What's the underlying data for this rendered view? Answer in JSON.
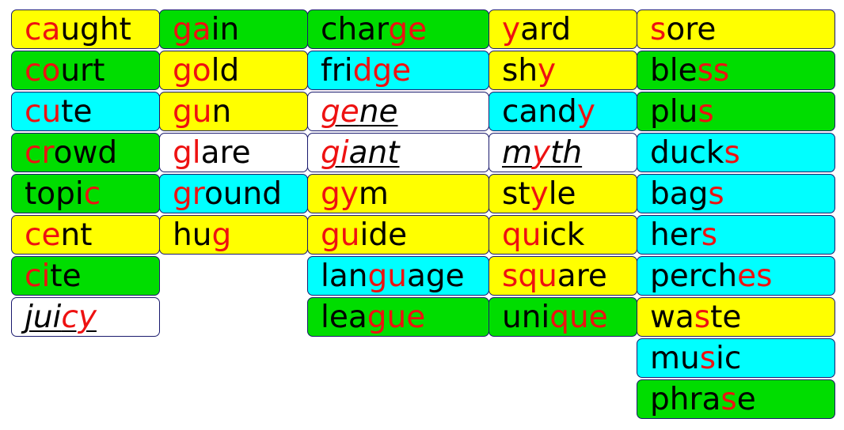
{
  "colors": {
    "yellow": "#ffff00",
    "green": "#00dd00",
    "cyan": "#00ffff",
    "white": "#ffffff",
    "highlight": "#ee1111",
    "text": "#000000"
  },
  "columns": [
    [
      {
        "word": "caught",
        "color": "yellow",
        "parts": [
          {
            "t": "ca",
            "h": true
          },
          {
            "t": "ught"
          }
        ]
      },
      {
        "word": "court",
        "color": "green",
        "parts": [
          {
            "t": "co",
            "h": true
          },
          {
            "t": "urt"
          }
        ]
      },
      {
        "word": "cute",
        "color": "cyan",
        "parts": [
          {
            "t": "cu",
            "h": true
          },
          {
            "t": "te"
          }
        ]
      },
      {
        "word": "crowd",
        "color": "green",
        "parts": [
          {
            "t": "cr",
            "h": true
          },
          {
            "t": "owd"
          }
        ]
      },
      {
        "word": "topic",
        "color": "green",
        "parts": [
          {
            "t": "topi"
          },
          {
            "t": "c",
            "h": true
          }
        ]
      },
      {
        "word": "cent",
        "color": "yellow",
        "parts": [
          {
            "t": "ce",
            "h": true
          },
          {
            "t": "nt"
          }
        ]
      },
      {
        "word": "cite",
        "color": "green",
        "parts": [
          {
            "t": "ci",
            "h": true
          },
          {
            "t": "te"
          }
        ]
      },
      {
        "word": "juicy",
        "color": "white",
        "italic": true,
        "parts": [
          {
            "t": "jui"
          },
          {
            "t": "cy",
            "h": true
          }
        ]
      }
    ],
    [
      {
        "word": "gain",
        "color": "green",
        "parts": [
          {
            "t": "ga",
            "h": true
          },
          {
            "t": "in"
          }
        ]
      },
      {
        "word": "gold",
        "color": "yellow",
        "parts": [
          {
            "t": "go",
            "h": true
          },
          {
            "t": "ld"
          }
        ]
      },
      {
        "word": "gun",
        "color": "yellow",
        "parts": [
          {
            "t": "gu",
            "h": true
          },
          {
            "t": "n"
          }
        ]
      },
      {
        "word": "glare",
        "color": "white",
        "parts": [
          {
            "t": "gl",
            "h": true
          },
          {
            "t": "are"
          }
        ]
      },
      {
        "word": "ground",
        "color": "cyan",
        "parts": [
          {
            "t": "gr",
            "h": true
          },
          {
            "t": "ound"
          }
        ]
      },
      {
        "word": "hug",
        "color": "yellow",
        "parts": [
          {
            "t": "hu"
          },
          {
            "t": "g",
            "h": true
          }
        ]
      }
    ],
    [
      {
        "word": "charge",
        "color": "green",
        "parts": [
          {
            "t": "char"
          },
          {
            "t": "ge",
            "h": true
          }
        ]
      },
      {
        "word": "fridge",
        "color": "cyan",
        "parts": [
          {
            "t": "fri"
          },
          {
            "t": "dge",
            "h": true
          }
        ]
      },
      {
        "word": "gene",
        "color": "white",
        "italic": true,
        "parts": [
          {
            "t": "ge",
            "h": true
          },
          {
            "t": "ne"
          }
        ]
      },
      {
        "word": "giant",
        "color": "white",
        "italic": true,
        "parts": [
          {
            "t": "gi",
            "h": true
          },
          {
            "t": "ant"
          }
        ]
      },
      {
        "word": "gym",
        "color": "yellow",
        "parts": [
          {
            "t": "gy",
            "h": true
          },
          {
            "t": "m"
          }
        ]
      },
      {
        "word": "guide",
        "color": "yellow",
        "parts": [
          {
            "t": "gu",
            "h": true
          },
          {
            "t": "ide"
          }
        ]
      },
      {
        "word": "language",
        "color": "cyan",
        "parts": [
          {
            "t": "lan"
          },
          {
            "t": "gu",
            "h": true
          },
          {
            "t": "age"
          }
        ]
      },
      {
        "word": "league",
        "color": "green",
        "parts": [
          {
            "t": "lea"
          },
          {
            "t": "gue",
            "h": true
          }
        ]
      }
    ],
    [
      {
        "word": "yard",
        "color": "yellow",
        "parts": [
          {
            "t": "y",
            "h": true
          },
          {
            "t": "ard"
          }
        ]
      },
      {
        "word": "shy",
        "color": "yellow",
        "parts": [
          {
            "t": "sh"
          },
          {
            "t": "y",
            "h": true
          }
        ]
      },
      {
        "word": "candy",
        "color": "cyan",
        "parts": [
          {
            "t": "cand"
          },
          {
            "t": "y",
            "h": true
          }
        ]
      },
      {
        "word": "myth",
        "color": "white",
        "italic": true,
        "parts": [
          {
            "t": "m"
          },
          {
            "t": "y",
            "h": true
          },
          {
            "t": "th"
          }
        ]
      },
      {
        "word": "style",
        "color": "yellow",
        "parts": [
          {
            "t": "st"
          },
          {
            "t": "y",
            "h": true
          },
          {
            "t": "le"
          }
        ]
      },
      {
        "word": "quick",
        "color": "yellow",
        "parts": [
          {
            "t": "qu",
            "h": true
          },
          {
            "t": "ick"
          }
        ]
      },
      {
        "word": "square",
        "color": "yellow",
        "parts": [
          {
            "t": "squ",
            "h": true
          },
          {
            "t": "are"
          }
        ]
      },
      {
        "word": "unique",
        "color": "green",
        "parts": [
          {
            "t": "uni"
          },
          {
            "t": "que",
            "h": true
          }
        ]
      }
    ],
    [
      {
        "word": "sore",
        "color": "yellow",
        "parts": [
          {
            "t": "s",
            "h": true
          },
          {
            "t": "ore"
          }
        ]
      },
      {
        "word": "bless",
        "color": "green",
        "parts": [
          {
            "t": "ble"
          },
          {
            "t": "ss",
            "h": true
          }
        ]
      },
      {
        "word": "plus",
        "color": "green",
        "parts": [
          {
            "t": "plu"
          },
          {
            "t": "s",
            "h": true
          }
        ]
      },
      {
        "word": "ducks",
        "color": "cyan",
        "parts": [
          {
            "t": "duck"
          },
          {
            "t": "s",
            "h": true
          }
        ]
      },
      {
        "word": "bags",
        "color": "cyan",
        "parts": [
          {
            "t": "bag"
          },
          {
            "t": "s",
            "h": true
          }
        ]
      },
      {
        "word": "hers",
        "color": "cyan",
        "parts": [
          {
            "t": "her"
          },
          {
            "t": "s",
            "h": true
          }
        ]
      },
      {
        "word": "perches",
        "color": "cyan",
        "parts": [
          {
            "t": "perch"
          },
          {
            "t": "es",
            "h": true
          }
        ]
      },
      {
        "word": "waste",
        "color": "yellow",
        "parts": [
          {
            "t": "wa"
          },
          {
            "t": "s",
            "h": true
          },
          {
            "t": "te"
          }
        ]
      },
      {
        "word": "music",
        "color": "cyan",
        "parts": [
          {
            "t": "mu"
          },
          {
            "t": "s",
            "h": true
          },
          {
            "t": "ic"
          }
        ]
      },
      {
        "word": "phrase",
        "color": "green",
        "parts": [
          {
            "t": "phra"
          },
          {
            "t": "s",
            "h": true
          },
          {
            "t": "e"
          }
        ]
      }
    ]
  ]
}
